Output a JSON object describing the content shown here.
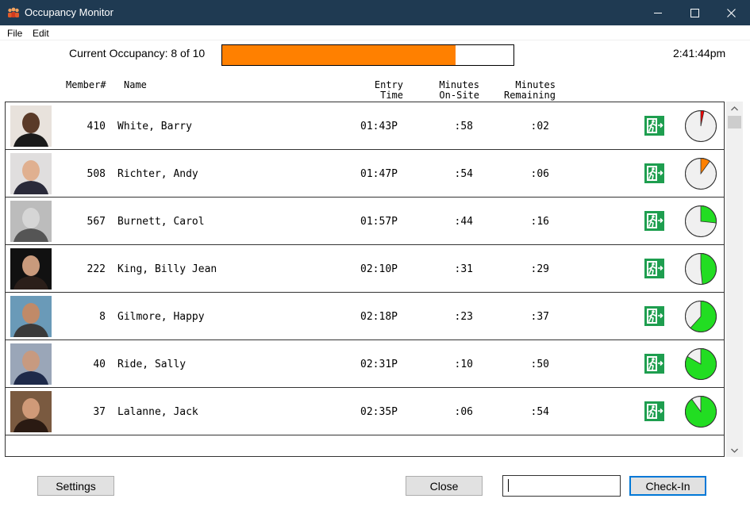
{
  "window": {
    "title": "Occupancy Monitor",
    "icon": "people-group-icon",
    "controls": [
      "minimize-icon",
      "maximize-icon",
      "close-icon"
    ]
  },
  "menu": {
    "file": "File",
    "edit": "Edit"
  },
  "occupancy": {
    "label": "Current Occupancy: 8 of 10",
    "current": 8,
    "capacity": 10,
    "fill_fraction": 0.8,
    "fill_color": "#ff8000"
  },
  "clock": "2:41:44pm",
  "columns": {
    "member": "Member#",
    "name": "Name",
    "entry_line1": "Entry",
    "entry_line2": "Time",
    "onsite_line1": "Minutes",
    "onsite_line2": "On-Site",
    "remaining_line1": "Minutes",
    "remaining_line2": "Remaining"
  },
  "rows": [
    {
      "member": "410",
      "name": "White, Barry",
      "entry": "01:43P",
      "onsite": ":58",
      "remaining": ":02",
      "remaining_fraction": 0.0333,
      "pie_color": "#ff0000",
      "photo": "member-photo"
    },
    {
      "member": "508",
      "name": "Richter, Andy",
      "entry": "01:47P",
      "onsite": ":54",
      "remaining": ":06",
      "remaining_fraction": 0.1,
      "pie_color": "#ff8000",
      "photo": "member-photo"
    },
    {
      "member": "567",
      "name": "Burnett, Carol",
      "entry": "01:57P",
      "onsite": ":44",
      "remaining": ":16",
      "remaining_fraction": 0.2667,
      "pie_color": "#22dd22",
      "photo": "member-photo"
    },
    {
      "member": "222",
      "name": "King, Billy Jean",
      "entry": "02:10P",
      "onsite": ":31",
      "remaining": ":29",
      "remaining_fraction": 0.4833,
      "pie_color": "#22dd22",
      "photo": "member-photo"
    },
    {
      "member": "8",
      "name": "Gilmore, Happy",
      "entry": "02:18P",
      "onsite": ":23",
      "remaining": ":37",
      "remaining_fraction": 0.6167,
      "pie_color": "#22dd22",
      "photo": "member-photo"
    },
    {
      "member": "40",
      "name": "Ride, Sally",
      "entry": "02:31P",
      "onsite": ":10",
      "remaining": ":50",
      "remaining_fraction": 0.8333,
      "pie_color": "#22dd22",
      "photo": "member-photo"
    },
    {
      "member": "37",
      "name": "Lalanne, Jack",
      "entry": "02:35P",
      "onsite": ":06",
      "remaining": ":54",
      "remaining_fraction": 0.9,
      "pie_color": "#22dd22",
      "photo": "member-photo"
    }
  ],
  "exit_icon": "emergency-exit-icon",
  "exit_icon_color": "#1e9e4f",
  "buttons": {
    "settings": "Settings",
    "close": "Close",
    "checkin": "Check-In"
  },
  "checkin_input": {
    "value": "",
    "placeholder": ""
  }
}
